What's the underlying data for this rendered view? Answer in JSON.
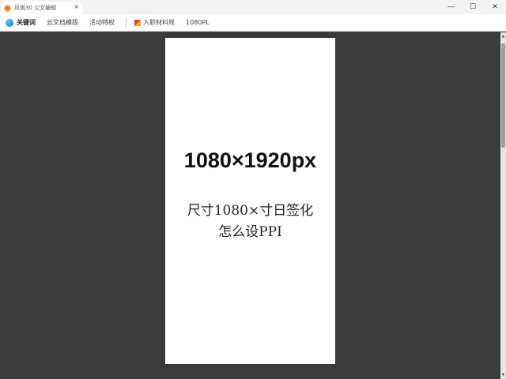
{
  "titlebar": {
    "tab_label": "风扇30 公文编辑",
    "close_glyph": "×",
    "minimize_glyph": "—",
    "maximize_glyph": "☐",
    "window_close_glyph": "✕"
  },
  "toolbar": {
    "brand": "关键词",
    "items": [
      "云文档模版",
      "活动特权",
      "入职材料规",
      "1080PL"
    ]
  },
  "page": {
    "title": "1080×1920px",
    "subtitle_line1": "尺寸1080×寸日签化",
    "subtitle_line2": "怎么设PPI"
  },
  "colors": {
    "workspace": "#3b3b3b",
    "page": "#ffffff",
    "accent": "#1679c9"
  }
}
